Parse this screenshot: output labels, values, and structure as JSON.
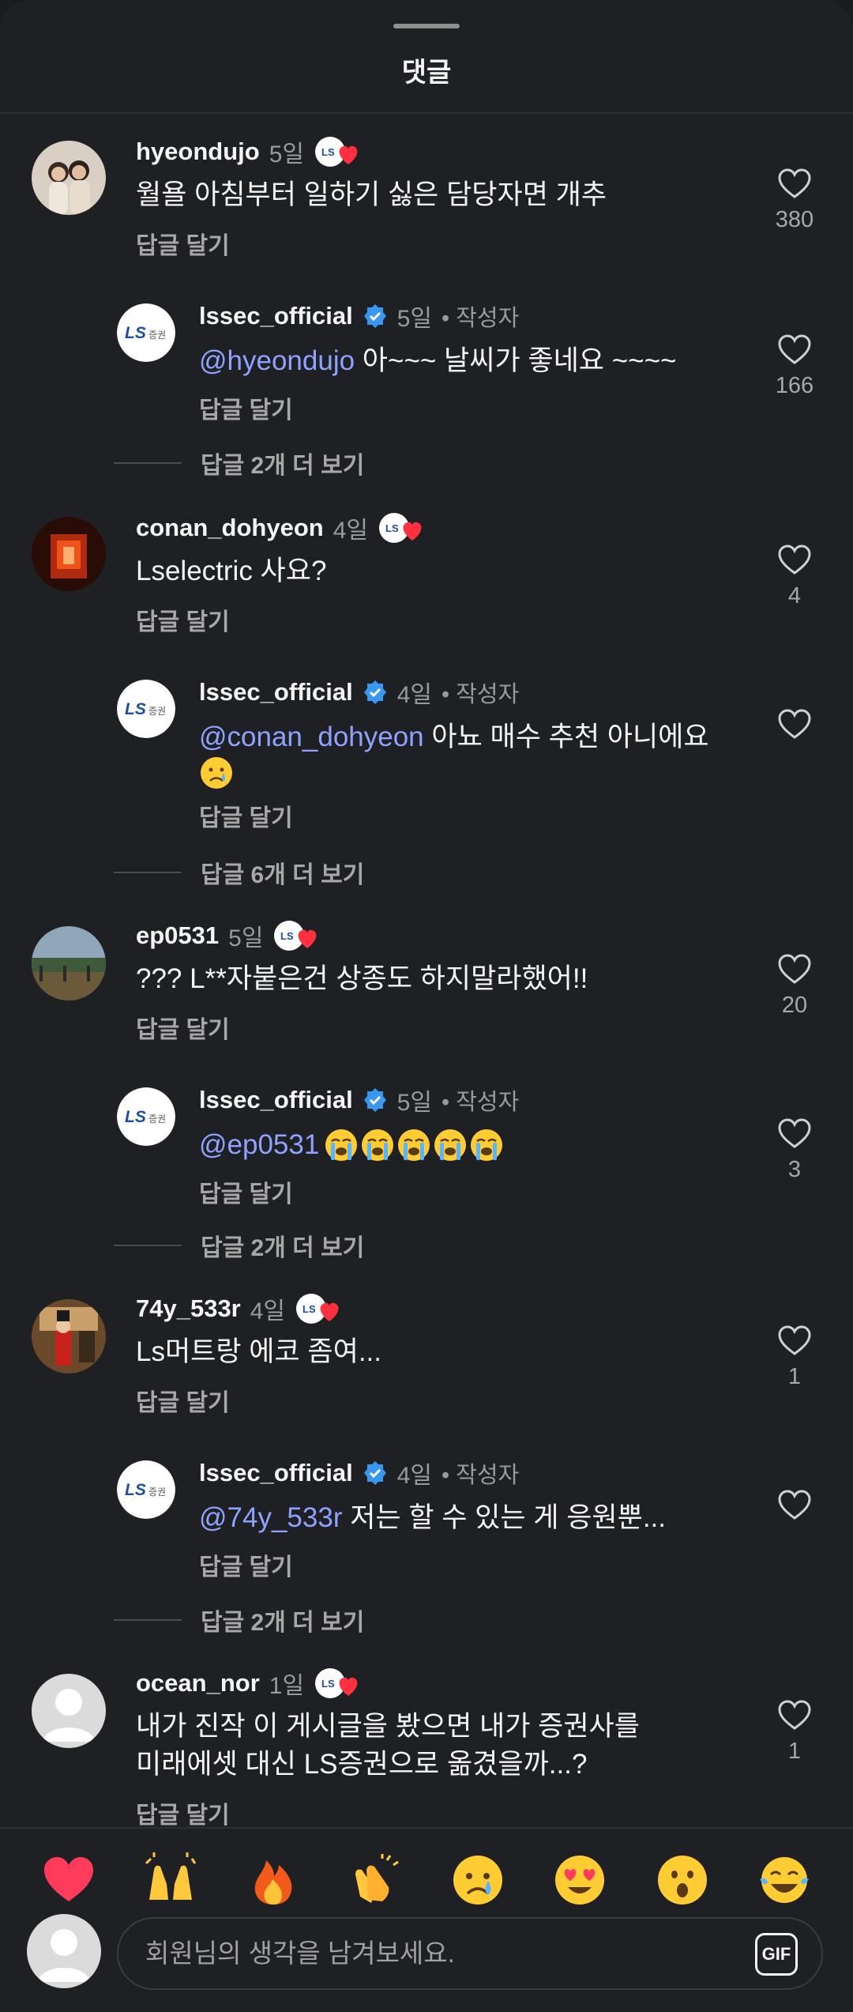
{
  "header": {
    "title": "댓글"
  },
  "comments": [
    {
      "username": "hyeondujo",
      "time": "5일",
      "text": "월욜 아침부터 일하기 싫은 담당자면 개추",
      "reply_label": "답글 달기",
      "likes": "380",
      "reply": {
        "username": "lssec_official",
        "time": "5일",
        "author_tag": "• 작성자",
        "mention": "@hyeondujo",
        "text": " 아~~~ 날씨가 좋네요 ~~~~",
        "reply_label": "답글 달기",
        "likes": "166"
      },
      "more_replies": "답글 2개 더 보기"
    },
    {
      "username": "conan_dohyeon",
      "time": "4일",
      "text": "Lselectric 사요?",
      "reply_label": "답글 달기",
      "likes": "4",
      "reply": {
        "username": "lssec_official",
        "time": "4일",
        "author_tag": "• 작성자",
        "mention": "@conan_dohyeon",
        "text": " 아뇨 매수 추천 아니에요",
        "reply_label": "답글 달기",
        "likes": ""
      },
      "more_replies": "답글 6개 더 보기"
    },
    {
      "username": "ep0531",
      "time": "5일",
      "text": "??? L**자붙은건 상종도 하지말라했어!!",
      "reply_label": "답글 달기",
      "likes": "20",
      "reply": {
        "username": "lssec_official",
        "time": "5일",
        "author_tag": "• 작성자",
        "mention": "@ep0531",
        "text": "",
        "reply_label": "답글 달기",
        "likes": "3"
      },
      "more_replies": "답글 2개 더 보기"
    },
    {
      "username": "74y_533r",
      "time": "4일",
      "text": "Ls머트랑 에코 좀여...",
      "reply_label": "답글 달기",
      "likes": "1",
      "reply": {
        "username": "lssec_official",
        "time": "4일",
        "author_tag": "• 작성자",
        "mention": "@74y_533r",
        "text": " 저는 할 수 있는 게 응원뿐...",
        "reply_label": "답글 달기",
        "likes": ""
      },
      "more_replies": "답글 2개 더 보기"
    },
    {
      "username": "ocean_nor",
      "time": "1일",
      "text_line1": "내가 진작 이 게시글을 봤으면 내가 증권사를",
      "text_line2": "미래에셋 대신 LS증권으로 옮겼을까...?",
      "reply_label": "답글 달기",
      "likes": "1"
    }
  ],
  "composer": {
    "placeholder": "회원님의 생각을 남겨보세요.",
    "gif_label": "GIF"
  },
  "reactions": [
    "heart",
    "raised-hands",
    "fire",
    "clapping-hands",
    "crying-face",
    "heart-eyes",
    "surprised-face",
    "tears-of-joy"
  ],
  "colors": {
    "background": "#1f2023",
    "mention": "#8ea2ff",
    "verified": "#3897f0",
    "heart_red": "#ff3040"
  }
}
